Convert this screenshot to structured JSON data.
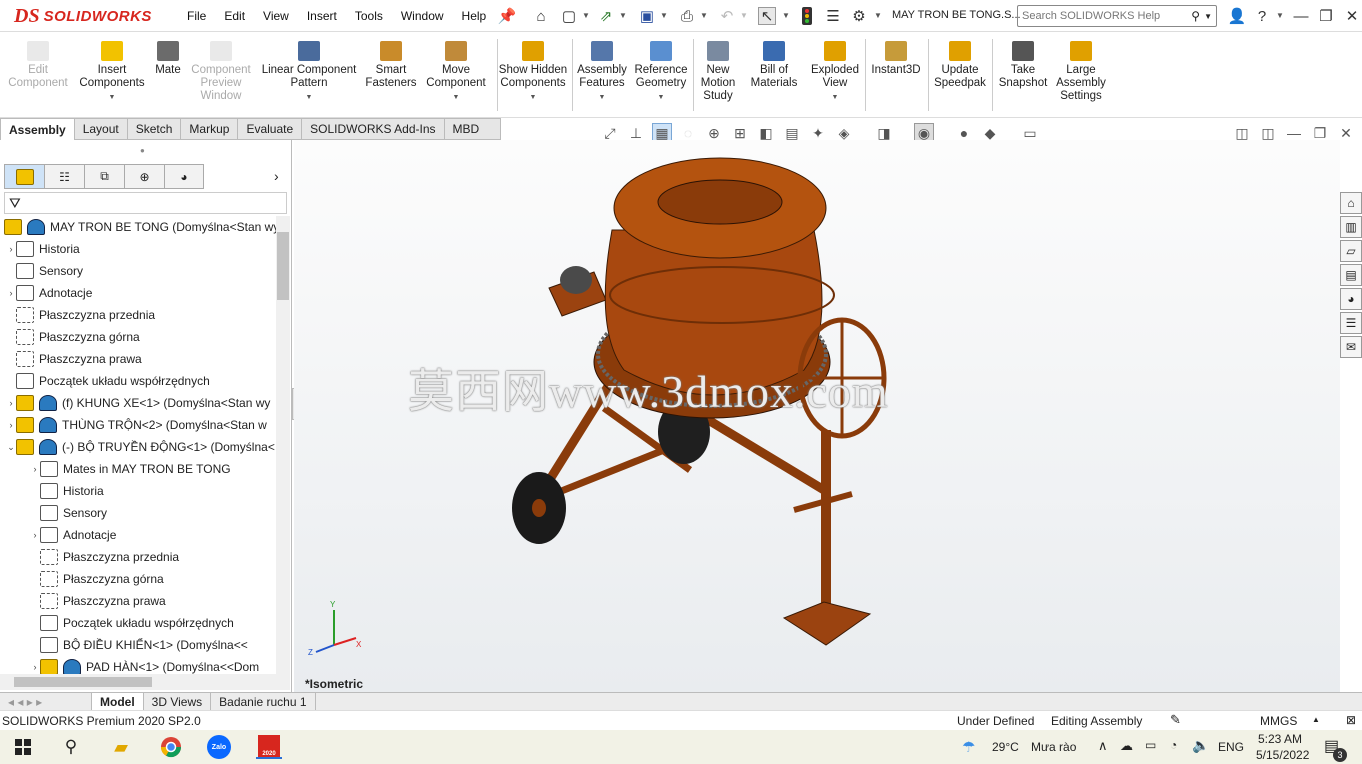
{
  "app": {
    "brand_ds": "DS",
    "brand_name": "SOLIDWORKS",
    "document_title": "MAY TRON BE TONG.S...",
    "search_placeholder": "Search SOLIDWORKS Help",
    "menus": [
      "File",
      "Edit",
      "View",
      "Insert",
      "Tools",
      "Window",
      "Help"
    ]
  },
  "commands": [
    {
      "label": "Edit Component",
      "disabled": true,
      "icon": "edit-component-icon"
    },
    {
      "label": "Insert Components",
      "icon": "insert-components-icon"
    },
    {
      "label": "Mate",
      "icon": "mate-icon"
    },
    {
      "label": "Component Preview Window",
      "disabled": true,
      "icon": "preview-window-icon"
    },
    {
      "label": "Linear Component Pattern",
      "icon": "linear-pattern-icon"
    },
    {
      "label": "Smart Fasteners",
      "icon": "smart-fasteners-icon"
    },
    {
      "label": "Move Component",
      "icon": "move-component-icon"
    },
    {
      "label": "Show Hidden Components",
      "icon": "show-hidden-icon"
    },
    {
      "label": "Assembly Features",
      "icon": "assembly-features-icon"
    },
    {
      "label": "Reference Geometry",
      "icon": "reference-geometry-icon"
    },
    {
      "label": "New Motion Study",
      "icon": "motion-study-icon"
    },
    {
      "label": "Bill of Materials",
      "icon": "bill-of-materials-icon"
    },
    {
      "label": "Exploded View",
      "icon": "exploded-view-icon"
    },
    {
      "label": "Instant3D",
      "icon": "instant3d-icon"
    },
    {
      "label": "Update Speedpak",
      "icon": "speedpak-icon"
    },
    {
      "label": "Take Snapshot",
      "icon": "snapshot-icon"
    },
    {
      "label": "Large Assembly Settings",
      "icon": "large-assembly-icon"
    }
  ],
  "ribbon_tabs": [
    "Assembly",
    "Layout",
    "Sketch",
    "Markup",
    "Evaluate",
    "SOLIDWORKS Add-Ins",
    "MBD"
  ],
  "tree": [
    {
      "label": "MAY TRON BE TONG  (Domyślna<Stan wy",
      "level": 0,
      "icon": "assembly"
    },
    {
      "label": "Historia",
      "level": 1,
      "icon": "history",
      "exp": "›"
    },
    {
      "label": "Sensory",
      "level": 1,
      "icon": "sensor"
    },
    {
      "label": "Adnotacje",
      "level": 1,
      "icon": "annotation",
      "exp": "›"
    },
    {
      "label": "Płaszczyzna przednia",
      "level": 1,
      "icon": "plane"
    },
    {
      "label": "Płaszczyzna górna",
      "level": 1,
      "icon": "plane"
    },
    {
      "label": "Płaszczyzna prawa",
      "level": 1,
      "icon": "plane"
    },
    {
      "label": "Początek układu współrzędnych",
      "level": 1,
      "icon": "origin"
    },
    {
      "label": "(f) KHUNG XE<1> (Domyślna<Stan wy",
      "level": 1,
      "icon": "assembly",
      "exp": "›"
    },
    {
      "label": "THÙNG TRỘN<2> (Domyślna<Stan w",
      "level": 1,
      "icon": "assembly",
      "exp": "›"
    },
    {
      "label": "(-) BỘ TRUYỀN ĐỘNG<1> (Domyślna<",
      "level": 1,
      "icon": "assembly",
      "exp": "⌄"
    },
    {
      "label": "Mates in MAY TRON BE TONG",
      "level": 2,
      "icon": "mates",
      "exp": "›"
    },
    {
      "label": "Historia",
      "level": 2,
      "icon": "history"
    },
    {
      "label": "Sensory",
      "level": 2,
      "icon": "sensor"
    },
    {
      "label": "Adnotacje",
      "level": 2,
      "icon": "annotation",
      "exp": "›"
    },
    {
      "label": "Płaszczyzna przednia",
      "level": 2,
      "icon": "plane"
    },
    {
      "label": "Płaszczyzna górna",
      "level": 2,
      "icon": "plane"
    },
    {
      "label": "Płaszczyzna prawa",
      "level": 2,
      "icon": "plane"
    },
    {
      "label": "Początek układu współrzędnych",
      "level": 2,
      "icon": "origin"
    },
    {
      "label": "BỘ ĐIỀU KHIỂN<1> (Domyślna<<",
      "level": 2,
      "icon": "part"
    },
    {
      "label": "PAD HÀN<1> (Domyślna<<Dom",
      "level": 2,
      "icon": "assembly",
      "exp": "›"
    }
  ],
  "viewport": {
    "view_label": "*Isometric",
    "watermark": "莫西网www.3dmox.com",
    "triad": {
      "x": "X",
      "y": "Y",
      "z": "Z"
    }
  },
  "bottom_tabs": [
    "Model",
    "3D Views",
    "Badanie ruchu 1"
  ],
  "status": {
    "version": "SOLIDWORKS Premium 2020 SP2.0",
    "definition": "Under Defined",
    "mode": "Editing Assembly",
    "units": "MMGS"
  },
  "taskbar": {
    "weather_temp": "29°C",
    "weather_desc": "Mưa rào",
    "language": "ENG",
    "time": "5:23 AM",
    "date": "5/15/2022",
    "notifications": "3",
    "zalo": "Zalo",
    "sw_badge": "2020"
  },
  "colors": {
    "brand_red": "#d7261e",
    "product_orange": "#b45309",
    "assembly_yellow": "#f2c200"
  }
}
